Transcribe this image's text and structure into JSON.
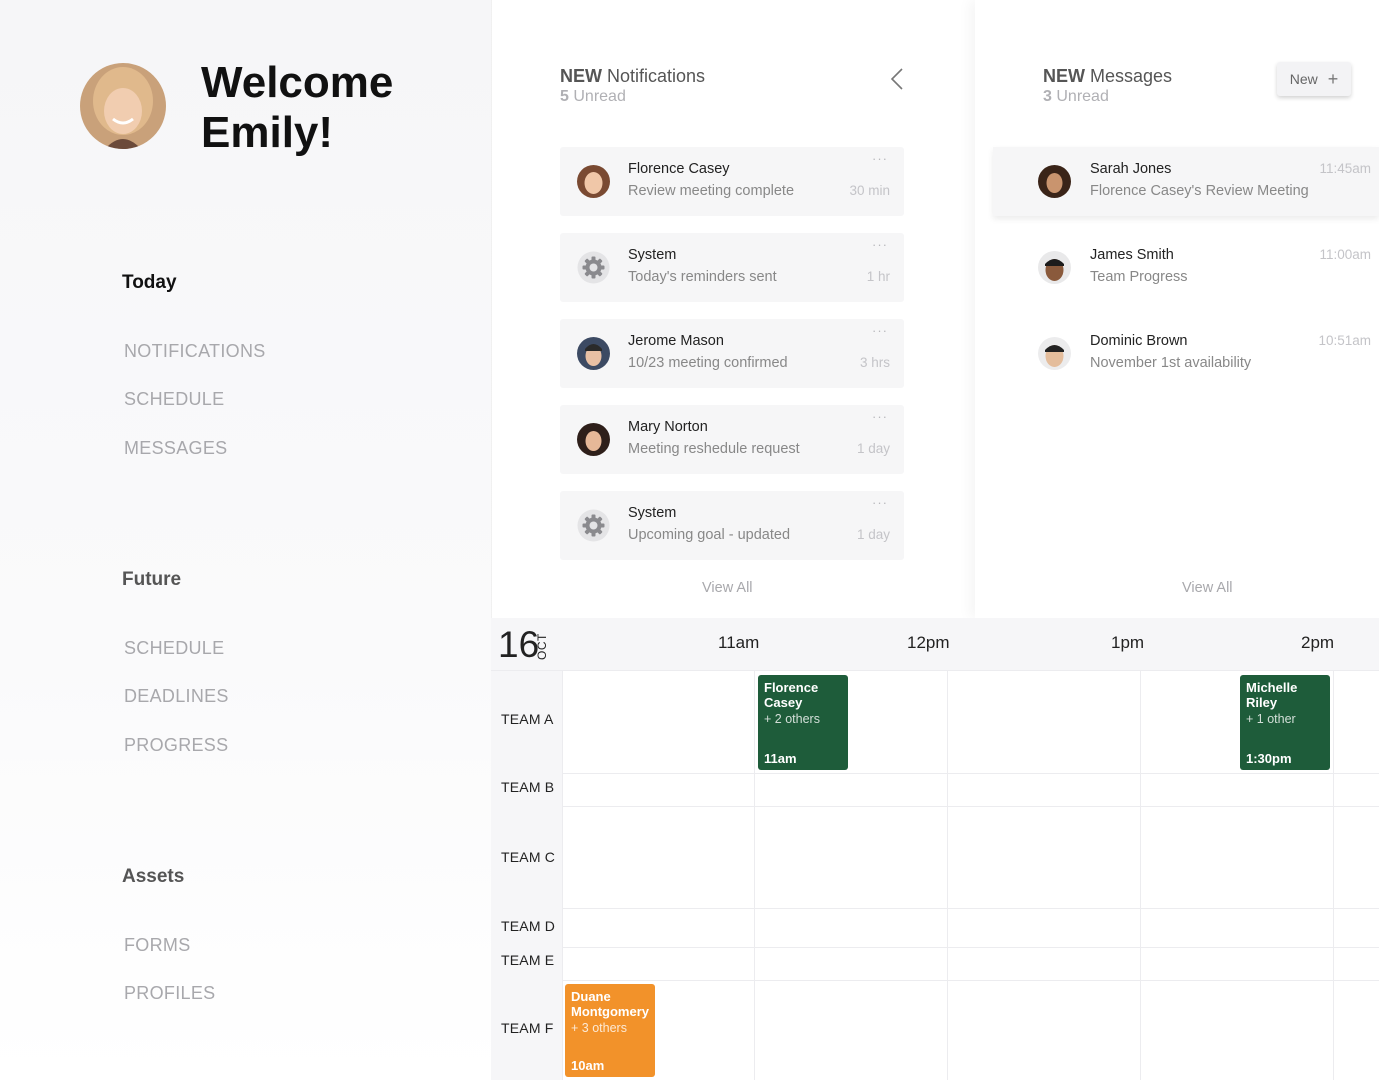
{
  "welcome": {
    "line1": "Welcome",
    "line2": "Emily!"
  },
  "sidebar": {
    "today": {
      "title": "Today",
      "items": [
        "NOTIFICATIONS",
        "SCHEDULE",
        "MESSAGES"
      ]
    },
    "future": {
      "title": "Future",
      "items": [
        "SCHEDULE",
        "DEADLINES",
        "PROGRESS"
      ]
    },
    "assets": {
      "title": "Assets",
      "items": [
        "FORMS",
        "PROFILES"
      ]
    }
  },
  "notifications": {
    "new_label": "NEW",
    "title": "Notifications",
    "unread_count": "5",
    "unread_label": "Unread",
    "view_all": "View All",
    "items": [
      {
        "name": "Florence Casey",
        "text": "Review meeting complete",
        "time": "30 min",
        "dots": "···"
      },
      {
        "name": "System",
        "text": "Today's reminders sent",
        "time": "1 hr",
        "dots": "···"
      },
      {
        "name": "Jerome Mason",
        "text": "10/23 meeting confirmed",
        "time": "3 hrs",
        "dots": "···"
      },
      {
        "name": "Mary Norton",
        "text": "Meeting reshedule request",
        "time": "1 day",
        "dots": "···"
      },
      {
        "name": "System",
        "text": "Upcoming goal - updated",
        "time": "1 day",
        "dots": "···"
      }
    ]
  },
  "messages": {
    "new_label": "NEW",
    "title": "Messages",
    "unread_count": "3",
    "unread_label": "Unread",
    "new_button": "New",
    "new_button_icon": "+",
    "view_all": "View All",
    "items": [
      {
        "name": "Sarah Jones",
        "text": "Florence Casey's Review Meeting",
        "time": "11:45am"
      },
      {
        "name": "James Smith",
        "text": "Team Progress",
        "time": "11:00am"
      },
      {
        "name": "Dominic Brown",
        "text": "November 1st availability",
        "time": "10:51am"
      }
    ]
  },
  "calendar": {
    "day": "16",
    "month": "OCT",
    "hours": [
      "11am",
      "12pm",
      "1pm",
      "2pm"
    ],
    "teams": [
      "TEAM A",
      "TEAM B",
      "TEAM C",
      "TEAM D",
      "TEAM E",
      "TEAM F"
    ],
    "events": [
      {
        "name": "Florence Casey",
        "others": "+ 2 others",
        "time": "11am",
        "color": "#1e5c3a"
      },
      {
        "name": "Michelle Riley",
        "others": "+ 1 other",
        "time": "1:30pm",
        "color": "#1e5c3a"
      },
      {
        "name": "Duane Montgomery",
        "others": "+ 3 others",
        "time": "10am",
        "color": "#f2922a"
      }
    ]
  },
  "icons": {
    "back": "chevron-left-icon",
    "gear": "gear-icon",
    "plus": "plus-icon"
  }
}
